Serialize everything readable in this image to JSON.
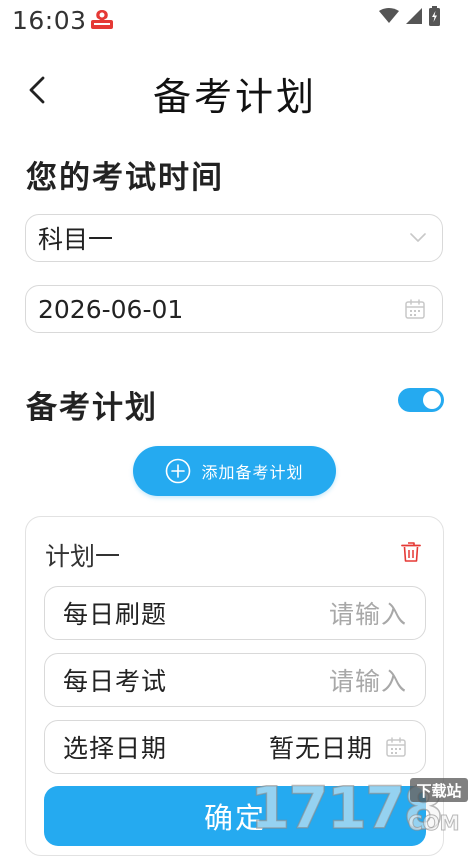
{
  "status_bar": {
    "time": "16:03"
  },
  "header": {
    "title": "备考计划"
  },
  "exam_section": {
    "title": "您的考试时间",
    "subject": {
      "value": "科目一"
    },
    "date": {
      "value": "2026-06-01"
    }
  },
  "plan_section": {
    "title": "备考计划",
    "toggle_on": true,
    "add_button_label": "添加备考计划"
  },
  "plan_card": {
    "name": "计划一",
    "rows": [
      {
        "label": "每日刷题",
        "placeholder": "请输入"
      },
      {
        "label": "每日考试",
        "placeholder": "请输入"
      },
      {
        "label": "选择日期",
        "value": "暂无日期"
      }
    ],
    "confirm_label": "确定"
  },
  "watermark": {
    "text": "17178",
    "suffix": "COM",
    "badge": "下载站"
  },
  "colors": {
    "accent": "#25aaf0",
    "delete": "#e53935",
    "border": "#d9d9d9",
    "placeholder": "#a8a8a8"
  }
}
